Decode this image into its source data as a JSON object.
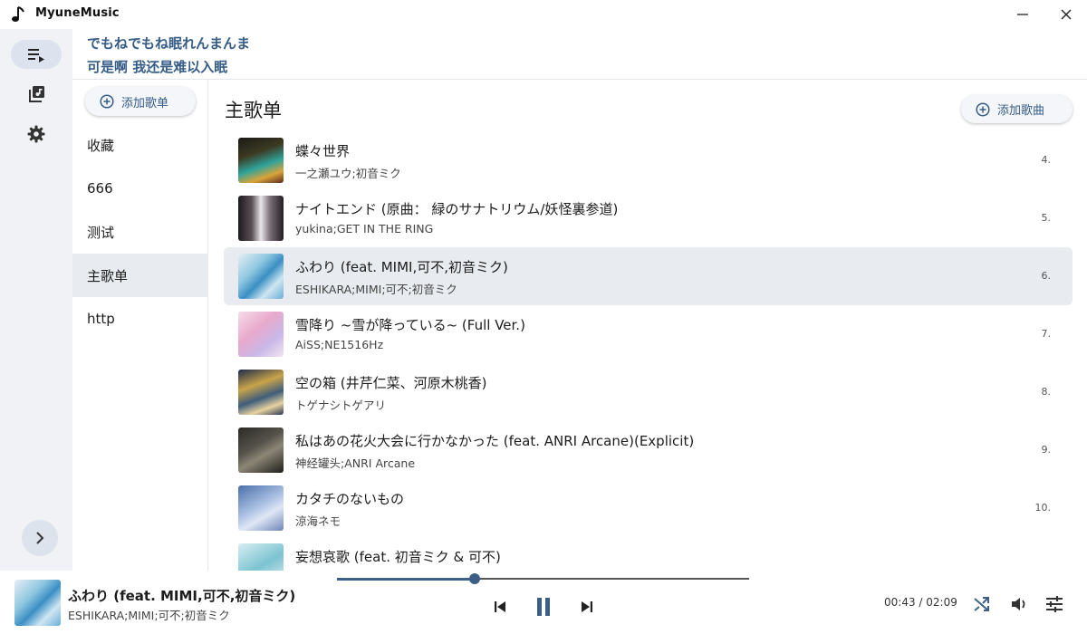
{
  "app": {
    "title": "MyuneMusic"
  },
  "lyrics": {
    "line1": "でもねでもね眠れんまんま",
    "line2": "可是啊 我还是难以入眠"
  },
  "playlists": {
    "add_label": "添加歌单",
    "items": [
      {
        "label": "收藏",
        "active": false
      },
      {
        "label": "666",
        "active": false
      },
      {
        "label": "测试",
        "active": false
      },
      {
        "label": "主歌单",
        "active": true
      },
      {
        "label": "http",
        "active": false
      }
    ]
  },
  "main": {
    "title": "主歌单",
    "add_song_label": "添加歌曲",
    "songs": [
      {
        "title": "蝶々世界",
        "artist": "一之瀬ユウ;初音ミク",
        "index": "4."
      },
      {
        "title": "ナイトエンド (原曲： 緑のサナトリウム/妖怪裏参道)",
        "artist": "yukina;GET IN THE RING",
        "index": "5."
      },
      {
        "title": "ふわり (feat. MIMI,可不,初音ミク)",
        "artist": "ESHIKARA;MIMI;可不;初音ミク",
        "index": "6.",
        "active": true
      },
      {
        "title": "雪降り ~雪が降っている~ (Full Ver.)",
        "artist": "AiSS;NE1516Hz",
        "index": "7."
      },
      {
        "title": "空の箱 (井芹仁菜、河原木桃香)",
        "artist": "トゲナシトゲアリ",
        "index": "8."
      },
      {
        "title": "私はあの花火大会に行かなかった (feat. ANRI Arcane)(Explicit)",
        "artist": "神经罐头;ANRI Arcane",
        "index": "9."
      },
      {
        "title": "カタチのないもの",
        "artist": "涼海ネモ",
        "index": "10."
      },
      {
        "title": "妄想哀歌 (feat. 初音ミク & 可不)",
        "artist": "",
        "index": ""
      }
    ]
  },
  "player": {
    "title": "ふわり (feat. MIMI,可不,初音ミク)",
    "artist": "ESHIKARA;MIMI;可不;初音ミク",
    "time": "00:43 / 02:09",
    "progress_fraction": 0.333
  },
  "icons": {
    "app": "music-note-icon",
    "rail": [
      "queue-play-icon",
      "library-music-icon",
      "settings-gear-icon"
    ],
    "expand": "chevron-right-icon",
    "player": [
      "previous-icon",
      "pause-icon",
      "next-icon",
      "shuffle-icon",
      "volume-icon",
      "equalizer-icon"
    ]
  },
  "colors": {
    "accent": "#355d87",
    "rail_bg": "#f0f2f5",
    "selected_bg": "#e8ebf0"
  }
}
